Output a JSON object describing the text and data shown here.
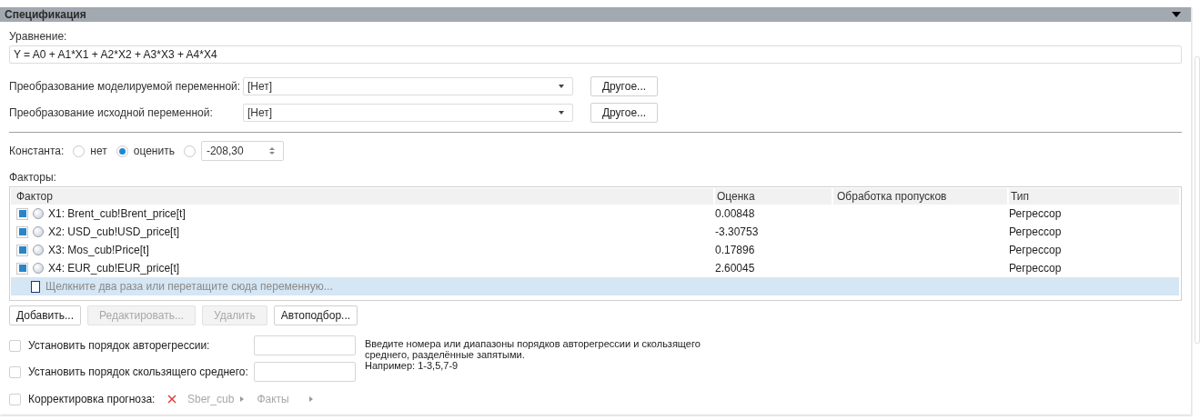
{
  "section": {
    "title": "Спецификация",
    "expanded": true
  },
  "equation": {
    "label": "Уравнение:",
    "value": "Y = A0 + A1*X1 + A2*X2 + A3*X3 + A4*X4"
  },
  "transforms": [
    {
      "label": "Преобразование моделируемой переменной:",
      "value": "[Нет]",
      "button": "Другое..."
    },
    {
      "label": "Преобразование исходной переменной:",
      "value": "[Нет]",
      "button": "Другое..."
    }
  ],
  "constant": {
    "label": "Константа:",
    "options": [
      {
        "kind": "label",
        "label": "нет",
        "selected": false
      },
      {
        "kind": "label",
        "label": "оценить",
        "selected": true
      },
      {
        "kind": "spin",
        "value": "-208,30",
        "selected": false
      }
    ]
  },
  "factors": {
    "label": "Факторы:",
    "columns": [
      "Фактор",
      "Оценка",
      "Обработка пропусков",
      "Тип"
    ],
    "rows": [
      {
        "checked": true,
        "factor": "X1: Brent_cub!Brent_price[t]",
        "estimate": "0.00848",
        "gaps": "",
        "type": "Регрессор"
      },
      {
        "checked": true,
        "factor": "X2: USD_cub!USD_price[t]",
        "estimate": "-3.30753",
        "gaps": "",
        "type": "Регрессор"
      },
      {
        "checked": true,
        "factor": "X3: Mos_cub!Price[t]",
        "estimate": "0.17896",
        "gaps": "",
        "type": "Регрессор"
      },
      {
        "checked": true,
        "factor": "X4: EUR_cub!EUR_price[t]",
        "estimate": "2.60045",
        "gaps": "",
        "type": "Регрессор"
      }
    ],
    "new_row_hint": "Щелкните два раза или перетащите сюда переменную..."
  },
  "buttons": [
    {
      "label": "Добавить...",
      "disabled": false
    },
    {
      "label": "Редактировать...",
      "disabled": true
    },
    {
      "label": "Удалить",
      "disabled": true
    },
    {
      "label": "Автоподбор...",
      "disabled": false
    }
  ],
  "order_options": [
    {
      "label": "Установить порядок авторегрессии:",
      "checked": false
    },
    {
      "label": "Установить порядок скользящего среднего:",
      "checked": false
    }
  ],
  "order_hint": [
    "Введите номера или диапазоны порядков авторегрессии и скользящего",
    "среднего, разделённые запятыми.",
    "Например: 1-3,5,7-9"
  ],
  "forecast_correction": {
    "label": "Корректировка прогноза:",
    "checked": false,
    "cube": "Sber_cub",
    "facts": "Факты"
  }
}
